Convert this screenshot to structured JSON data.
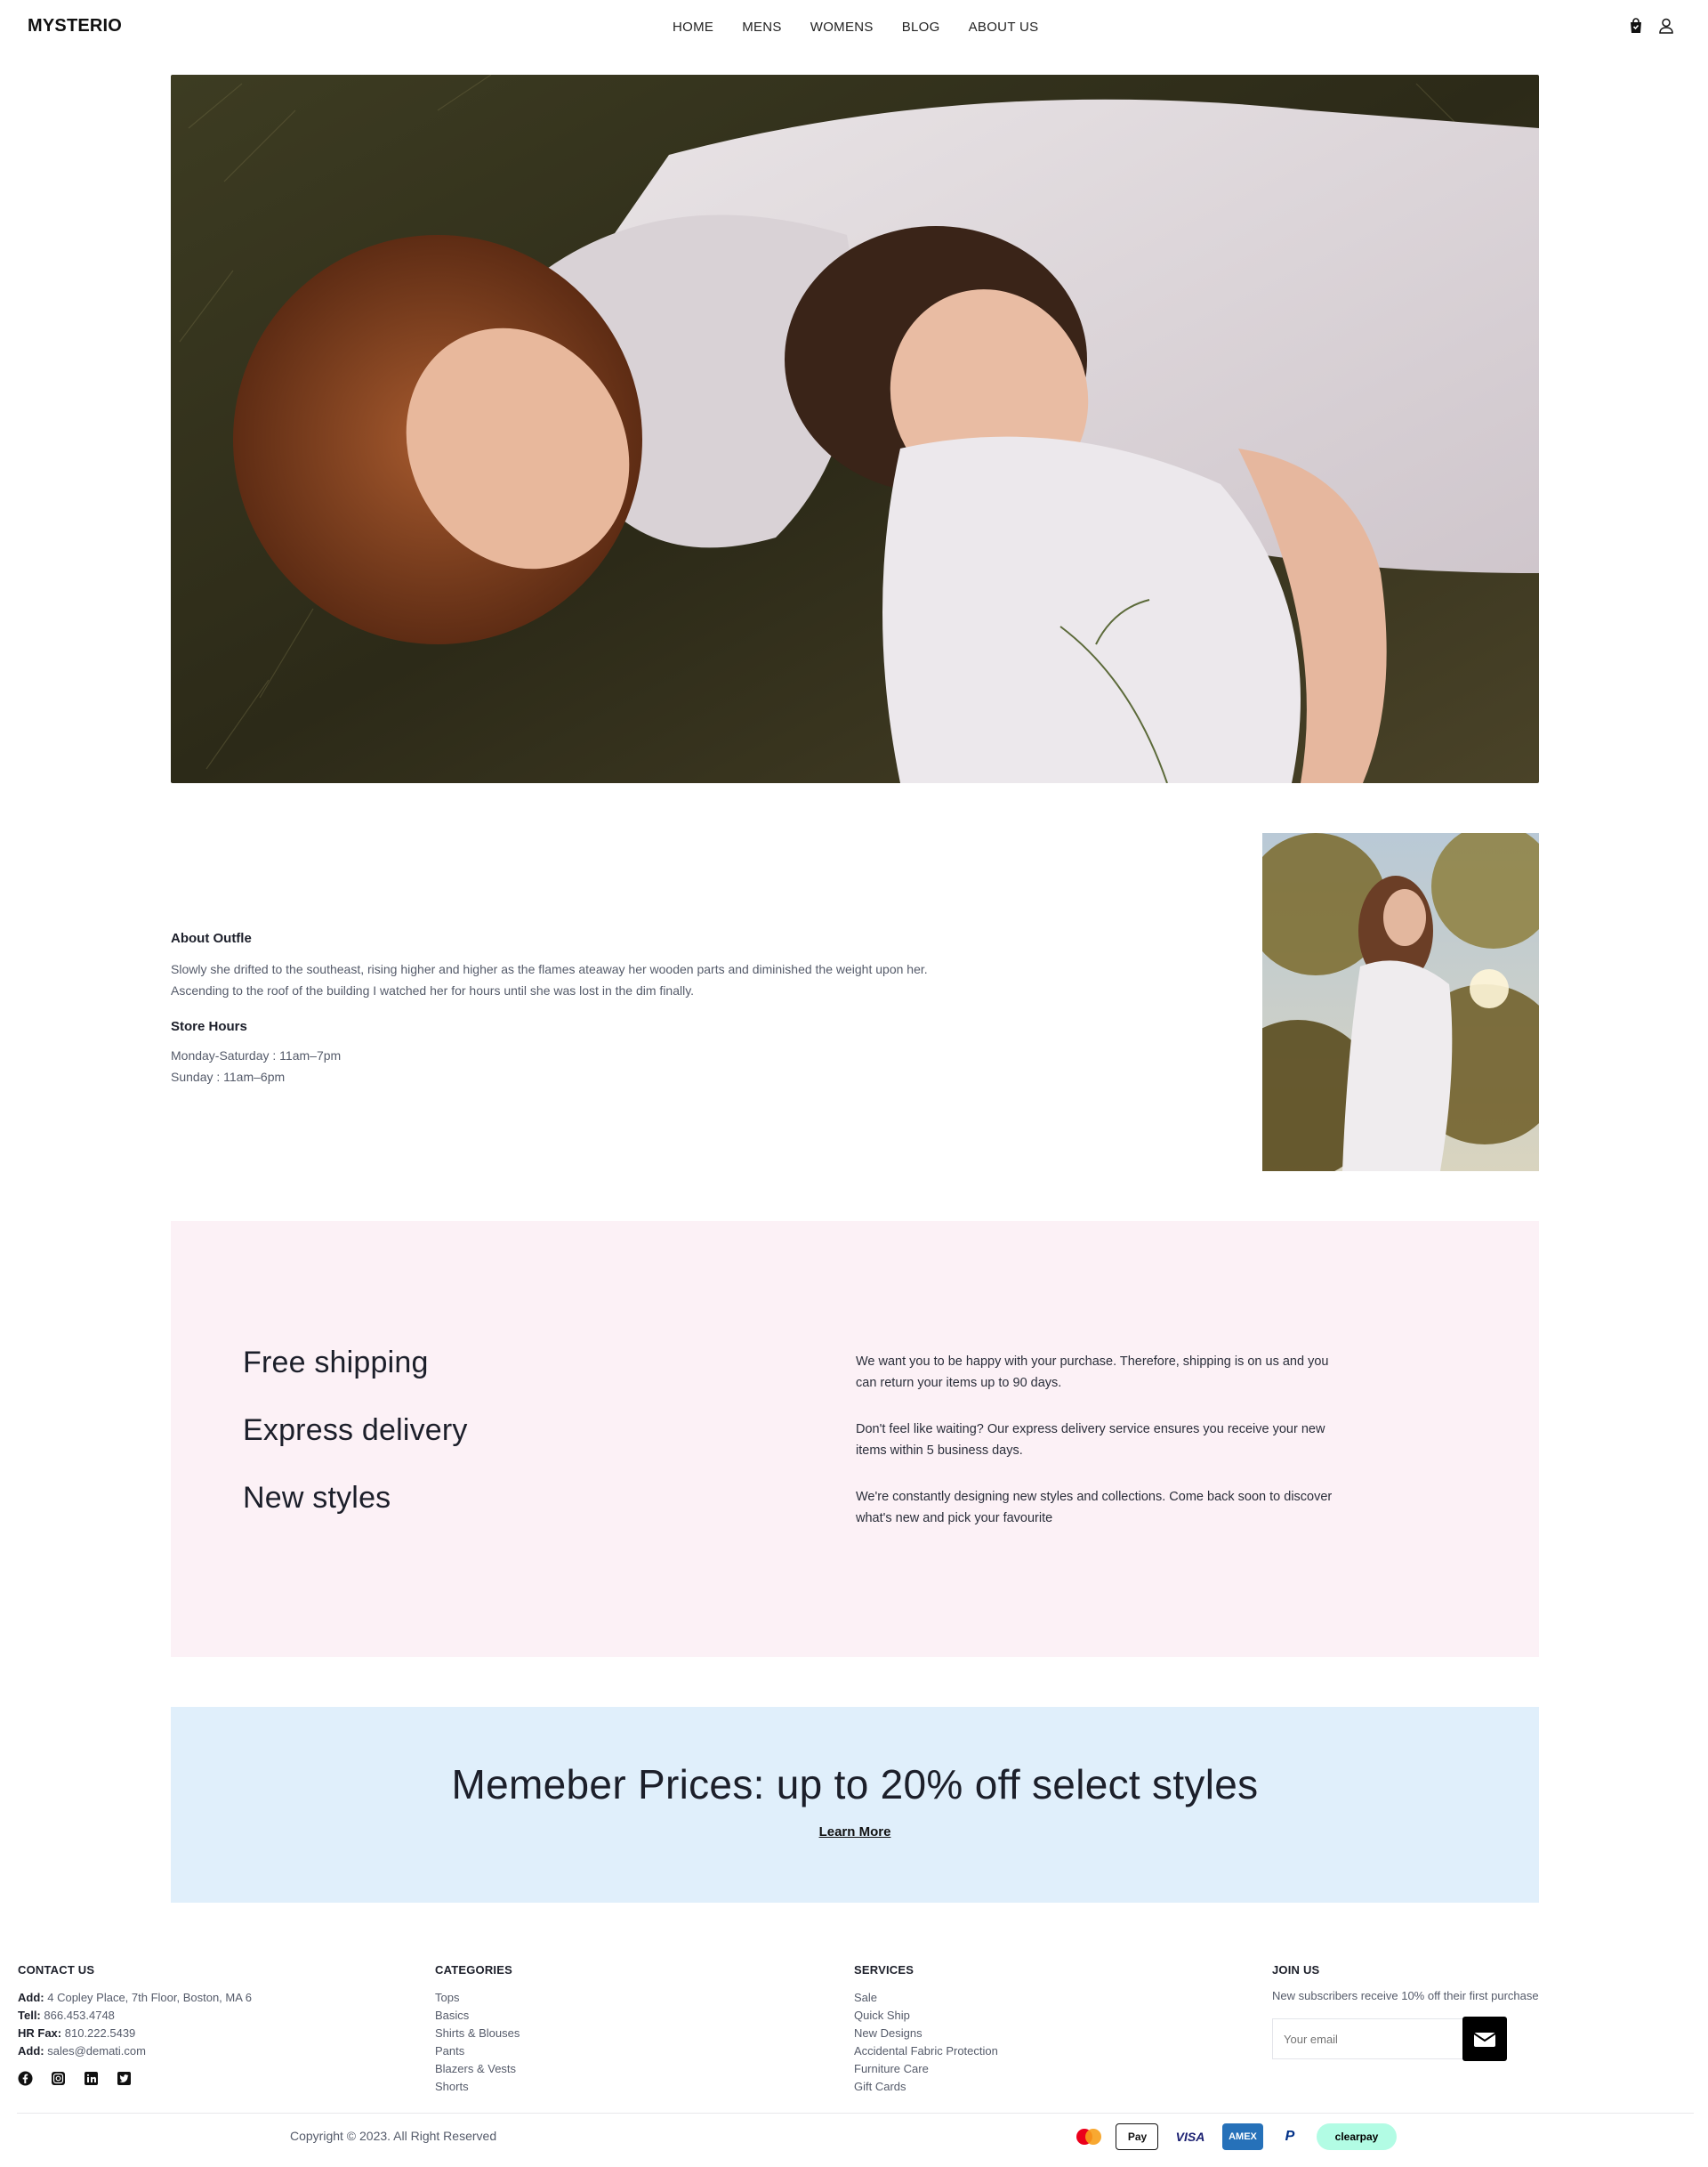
{
  "header": {
    "logo": "MYSTERIO",
    "nav": [
      "HOME",
      "MENS",
      "WOMENS",
      "BLOG",
      "ABOUT US"
    ]
  },
  "about": {
    "title": "About Outfle",
    "body": "Slowly she drifted to the southeast, rising higher and higher as the flames ateaway her wooden parts and diminished the weight upon her. Ascending to the roof of the building I watched her for hours until she was lost in the dim finally.",
    "hours_title": "Store Hours",
    "hours": [
      "Monday-Saturday : 11am–7pm",
      "Sunday : 11am–6pm"
    ]
  },
  "features": {
    "titles": [
      "Free shipping",
      "Express delivery",
      "New styles"
    ],
    "texts": [
      "We want you to be happy with your purchase. Therefore, shipping is on us and you can return your items up to 90 days.",
      "Don't feel like waiting? Our express delivery service ensures you receive your new items within 5 business days.",
      "We're constantly designing new styles and collections. Come back soon to discover what's new and pick your favourite"
    ]
  },
  "member": {
    "headline": "Memeber Prices: up to 20% off select styles",
    "link": "Learn More"
  },
  "footer": {
    "contact": {
      "title": "CONTACT US",
      "rows": [
        {
          "label": "Add:",
          "value": "4 Copley Place, 7th Floor, Boston, MA 6"
        },
        {
          "label": "Tell:",
          "value": "866.453.4748"
        },
        {
          "label": "HR Fax:",
          "value": "810.222.5439"
        },
        {
          "label": "Add:",
          "value": "sales@demati.com"
        }
      ]
    },
    "categories": {
      "title": "CATEGORIES",
      "items": [
        "Tops",
        "Basics",
        "Shirts & Blouses",
        "Pants",
        "Blazers & Vests",
        "Shorts"
      ]
    },
    "services": {
      "title": "SERVICES",
      "items": [
        "Sale",
        "Quick Ship",
        "New Designs",
        "Accidental Fabric Protection",
        "Furniture Care",
        "Gift Cards"
      ]
    },
    "join": {
      "title": "JOIN US",
      "text": "New subscribers receive 10% off their first purchase",
      "placeholder": "Your email"
    },
    "copyright": "Copyright © 2023. All Right Reserved",
    "payments": {
      "applepay": "Pay",
      "visa": "VISA",
      "amex": "AMEX",
      "paypal": "P",
      "clearpay": "clearpay"
    }
  }
}
